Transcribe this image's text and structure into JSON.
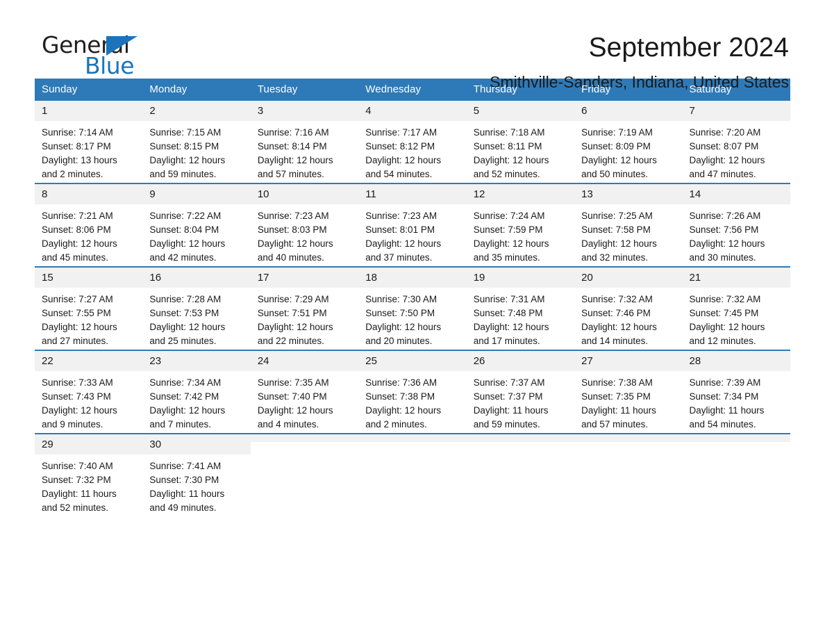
{
  "brand": {
    "name_part1": "General",
    "name_part2": "Blue",
    "triangle_color": "#1b74bb",
    "accent_color": "#2e7ab8"
  },
  "header": {
    "title": "September 2024",
    "subtitle": "Smithville-Sanders, Indiana, United States"
  },
  "calendar": {
    "weekday_headers": [
      "Sunday",
      "Monday",
      "Tuesday",
      "Wednesday",
      "Thursday",
      "Friday",
      "Saturday"
    ],
    "weeks": [
      {
        "days": [
          {
            "date": "1",
            "sunrise": "Sunrise: 7:14 AM",
            "sunset": "Sunset: 8:17 PM",
            "daylight_line1": "Daylight: 13 hours",
            "daylight_line2": "and 2 minutes."
          },
          {
            "date": "2",
            "sunrise": "Sunrise: 7:15 AM",
            "sunset": "Sunset: 8:15 PM",
            "daylight_line1": "Daylight: 12 hours",
            "daylight_line2": "and 59 minutes."
          },
          {
            "date": "3",
            "sunrise": "Sunrise: 7:16 AM",
            "sunset": "Sunset: 8:14 PM",
            "daylight_line1": "Daylight: 12 hours",
            "daylight_line2": "and 57 minutes."
          },
          {
            "date": "4",
            "sunrise": "Sunrise: 7:17 AM",
            "sunset": "Sunset: 8:12 PM",
            "daylight_line1": "Daylight: 12 hours",
            "daylight_line2": "and 54 minutes."
          },
          {
            "date": "5",
            "sunrise": "Sunrise: 7:18 AM",
            "sunset": "Sunset: 8:11 PM",
            "daylight_line1": "Daylight: 12 hours",
            "daylight_line2": "and 52 minutes."
          },
          {
            "date": "6",
            "sunrise": "Sunrise: 7:19 AM",
            "sunset": "Sunset: 8:09 PM",
            "daylight_line1": "Daylight: 12 hours",
            "daylight_line2": "and 50 minutes."
          },
          {
            "date": "7",
            "sunrise": "Sunrise: 7:20 AM",
            "sunset": "Sunset: 8:07 PM",
            "daylight_line1": "Daylight: 12 hours",
            "daylight_line2": "and 47 minutes."
          }
        ]
      },
      {
        "days": [
          {
            "date": "8",
            "sunrise": "Sunrise: 7:21 AM",
            "sunset": "Sunset: 8:06 PM",
            "daylight_line1": "Daylight: 12 hours",
            "daylight_line2": "and 45 minutes."
          },
          {
            "date": "9",
            "sunrise": "Sunrise: 7:22 AM",
            "sunset": "Sunset: 8:04 PM",
            "daylight_line1": "Daylight: 12 hours",
            "daylight_line2": "and 42 minutes."
          },
          {
            "date": "10",
            "sunrise": "Sunrise: 7:23 AM",
            "sunset": "Sunset: 8:03 PM",
            "daylight_line1": "Daylight: 12 hours",
            "daylight_line2": "and 40 minutes."
          },
          {
            "date": "11",
            "sunrise": "Sunrise: 7:23 AM",
            "sunset": "Sunset: 8:01 PM",
            "daylight_line1": "Daylight: 12 hours",
            "daylight_line2": "and 37 minutes."
          },
          {
            "date": "12",
            "sunrise": "Sunrise: 7:24 AM",
            "sunset": "Sunset: 7:59 PM",
            "daylight_line1": "Daylight: 12 hours",
            "daylight_line2": "and 35 minutes."
          },
          {
            "date": "13",
            "sunrise": "Sunrise: 7:25 AM",
            "sunset": "Sunset: 7:58 PM",
            "daylight_line1": "Daylight: 12 hours",
            "daylight_line2": "and 32 minutes."
          },
          {
            "date": "14",
            "sunrise": "Sunrise: 7:26 AM",
            "sunset": "Sunset: 7:56 PM",
            "daylight_line1": "Daylight: 12 hours",
            "daylight_line2": "and 30 minutes."
          }
        ]
      },
      {
        "days": [
          {
            "date": "15",
            "sunrise": "Sunrise: 7:27 AM",
            "sunset": "Sunset: 7:55 PM",
            "daylight_line1": "Daylight: 12 hours",
            "daylight_line2": "and 27 minutes."
          },
          {
            "date": "16",
            "sunrise": "Sunrise: 7:28 AM",
            "sunset": "Sunset: 7:53 PM",
            "daylight_line1": "Daylight: 12 hours",
            "daylight_line2": "and 25 minutes."
          },
          {
            "date": "17",
            "sunrise": "Sunrise: 7:29 AM",
            "sunset": "Sunset: 7:51 PM",
            "daylight_line1": "Daylight: 12 hours",
            "daylight_line2": "and 22 minutes."
          },
          {
            "date": "18",
            "sunrise": "Sunrise: 7:30 AM",
            "sunset": "Sunset: 7:50 PM",
            "daylight_line1": "Daylight: 12 hours",
            "daylight_line2": "and 20 minutes."
          },
          {
            "date": "19",
            "sunrise": "Sunrise: 7:31 AM",
            "sunset": "Sunset: 7:48 PM",
            "daylight_line1": "Daylight: 12 hours",
            "daylight_line2": "and 17 minutes."
          },
          {
            "date": "20",
            "sunrise": "Sunrise: 7:32 AM",
            "sunset": "Sunset: 7:46 PM",
            "daylight_line1": "Daylight: 12 hours",
            "daylight_line2": "and 14 minutes."
          },
          {
            "date": "21",
            "sunrise": "Sunrise: 7:32 AM",
            "sunset": "Sunset: 7:45 PM",
            "daylight_line1": "Daylight: 12 hours",
            "daylight_line2": "and 12 minutes."
          }
        ]
      },
      {
        "days": [
          {
            "date": "22",
            "sunrise": "Sunrise: 7:33 AM",
            "sunset": "Sunset: 7:43 PM",
            "daylight_line1": "Daylight: 12 hours",
            "daylight_line2": "and 9 minutes."
          },
          {
            "date": "23",
            "sunrise": "Sunrise: 7:34 AM",
            "sunset": "Sunset: 7:42 PM",
            "daylight_line1": "Daylight: 12 hours",
            "daylight_line2": "and 7 minutes."
          },
          {
            "date": "24",
            "sunrise": "Sunrise: 7:35 AM",
            "sunset": "Sunset: 7:40 PM",
            "daylight_line1": "Daylight: 12 hours",
            "daylight_line2": "and 4 minutes."
          },
          {
            "date": "25",
            "sunrise": "Sunrise: 7:36 AM",
            "sunset": "Sunset: 7:38 PM",
            "daylight_line1": "Daylight: 12 hours",
            "daylight_line2": "and 2 minutes."
          },
          {
            "date": "26",
            "sunrise": "Sunrise: 7:37 AM",
            "sunset": "Sunset: 7:37 PM",
            "daylight_line1": "Daylight: 11 hours",
            "daylight_line2": "and 59 minutes."
          },
          {
            "date": "27",
            "sunrise": "Sunrise: 7:38 AM",
            "sunset": "Sunset: 7:35 PM",
            "daylight_line1": "Daylight: 11 hours",
            "daylight_line2": "and 57 minutes."
          },
          {
            "date": "28",
            "sunrise": "Sunrise: 7:39 AM",
            "sunset": "Sunset: 7:34 PM",
            "daylight_line1": "Daylight: 11 hours",
            "daylight_line2": "and 54 minutes."
          }
        ]
      },
      {
        "days": [
          {
            "date": "29",
            "sunrise": "Sunrise: 7:40 AM",
            "sunset": "Sunset: 7:32 PM",
            "daylight_line1": "Daylight: 11 hours",
            "daylight_line2": "and 52 minutes."
          },
          {
            "date": "30",
            "sunrise": "Sunrise: 7:41 AM",
            "sunset": "Sunset: 7:30 PM",
            "daylight_line1": "Daylight: 11 hours",
            "daylight_line2": "and 49 minutes."
          },
          {
            "date": "",
            "sunrise": "",
            "sunset": "",
            "daylight_line1": "",
            "daylight_line2": ""
          },
          {
            "date": "",
            "sunrise": "",
            "sunset": "",
            "daylight_line1": "",
            "daylight_line2": ""
          },
          {
            "date": "",
            "sunrise": "",
            "sunset": "",
            "daylight_line1": "",
            "daylight_line2": ""
          },
          {
            "date": "",
            "sunrise": "",
            "sunset": "",
            "daylight_line1": "",
            "daylight_line2": ""
          },
          {
            "date": "",
            "sunrise": "",
            "sunset": "",
            "daylight_line1": "",
            "daylight_line2": ""
          }
        ]
      }
    ]
  }
}
